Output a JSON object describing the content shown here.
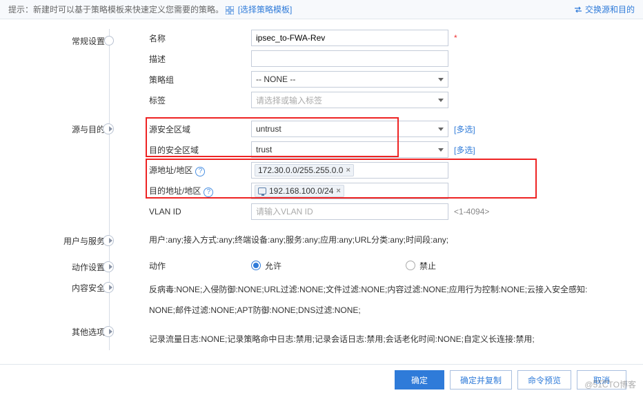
{
  "topbar": {
    "hint": "提示：新建时可以基于策略模板来快速定义您需要的策略。",
    "template_link": "[选择策略模板]",
    "swap_link": "交换源和目的"
  },
  "sections": {
    "general": "常规设置",
    "src_dst": "源与目的",
    "user_service": "用户与服务",
    "action": "动作设置",
    "content_security": "内容安全",
    "other_options": "其他选项"
  },
  "labels": {
    "name": "名称",
    "description": "描述",
    "policy_group": "策略组",
    "tag": "标签",
    "src_zone": "源安全区域",
    "dst_zone": "目的安全区域",
    "src_addr": "源地址/地区",
    "dst_addr": "目的地址/地区",
    "vlan_id": "VLAN ID",
    "action_label": "动作",
    "more": "[多选]"
  },
  "values": {
    "name": "ipsec_to-FWA-Rev",
    "policy_group": "-- NONE --",
    "tag_placeholder": "请选择或输入标签",
    "src_zone": "untrust",
    "dst_zone": "trust",
    "src_addr_chip": "172.30.0.0/255.255.0.0",
    "dst_addr_chip": "192.168.100.0/24",
    "vlan_placeholder": "请输入VLAN ID",
    "vlan_hint": "<1-4094>"
  },
  "radios": {
    "allow": "允许",
    "deny": "禁止"
  },
  "summaries": {
    "user_service": "用户:any;接入方式:any;终端设备:any;服务:any;应用:any;URL分类:any;时间段:any;",
    "content_security_a": "反病毒:NONE;入侵防御:NONE;URL过滤:NONE;文件过滤:NONE;内容过滤:NONE;应用行为控制:NONE;云接入安全感知:",
    "content_security_b": "NONE;邮件过滤:NONE;APT防御:NONE;DNS过滤:NONE;",
    "other_options": "记录流量日志:NONE;记录策略命中日志:禁用;记录会话日志:禁用;会话老化时间:NONE;自定义长连接:禁用;"
  },
  "buttons": {
    "ok": "确定",
    "ok_copy": "确定并复制",
    "preview": "命令预览",
    "cancel": "取消"
  },
  "watermark": "@51CTO博客"
}
